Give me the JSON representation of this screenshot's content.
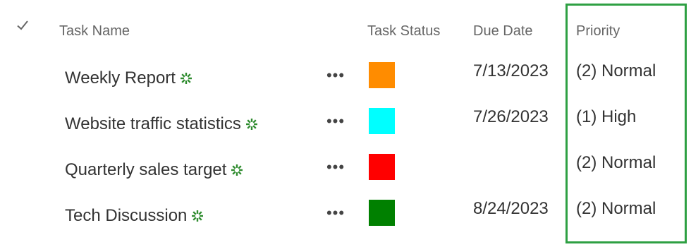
{
  "header": {
    "task_name": "Task Name",
    "task_status": "Task Status",
    "due_date": "Due Date",
    "priority": "Priority"
  },
  "colors": {
    "highlight_border": "#2ea043",
    "new_icon": "#2e8b2e"
  },
  "rows": [
    {
      "title": "Weekly Report",
      "ellipsis": "•••",
      "status_color": "#ff8c00",
      "due_date": "7/13/2023",
      "priority": "(2) Normal"
    },
    {
      "title": "Website traffic statistics",
      "ellipsis": "•••",
      "status_color": "#00ffff",
      "due_date": "7/26/2023",
      "priority": "(1) High"
    },
    {
      "title": "Quarterly sales target",
      "ellipsis": "•••",
      "status_color": "#ff0000",
      "due_date": "",
      "priority": "(2) Normal"
    },
    {
      "title": "Tech Discussion",
      "ellipsis": "•••",
      "status_color": "#008000",
      "due_date": "8/24/2023",
      "priority": "(2) Normal"
    }
  ]
}
